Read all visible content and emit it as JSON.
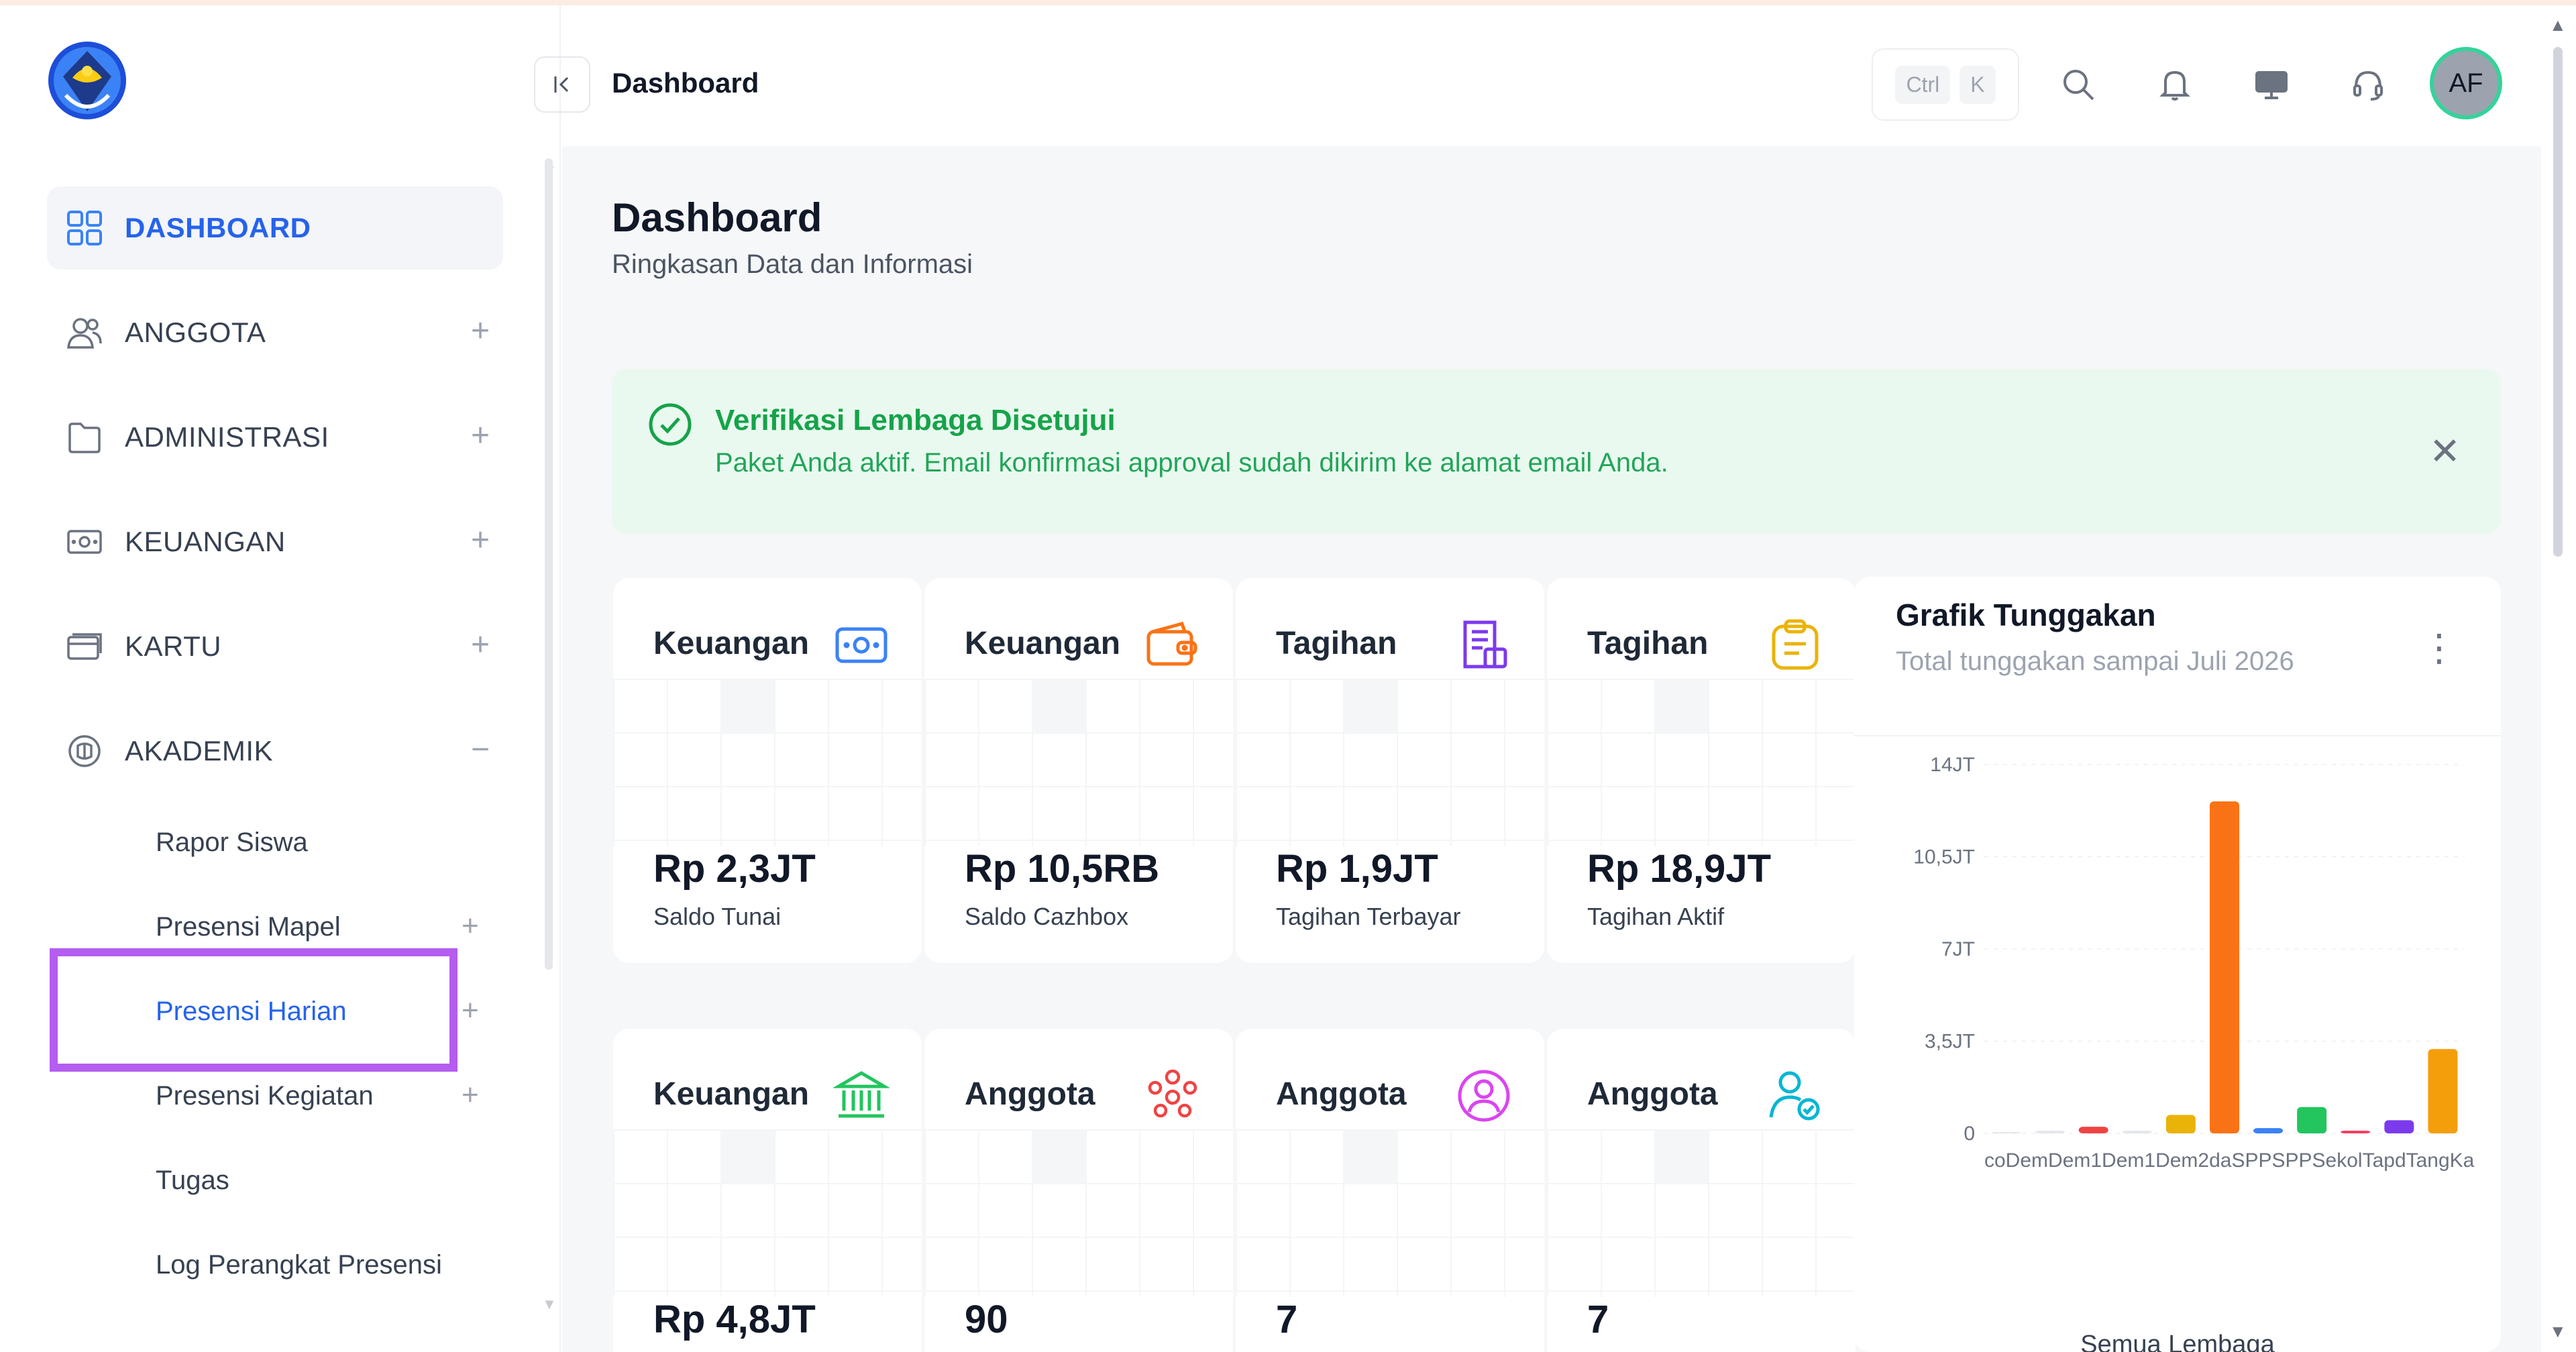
{
  "header": {
    "title": "Dashboard",
    "kbd_ctrl": "Ctrl",
    "kbd_k": "K",
    "avatar_initials": "AF"
  },
  "sidebar": {
    "items": [
      {
        "label": "DASHBOARD",
        "icon": "grid-icon",
        "active": true
      },
      {
        "label": "ANGGOTA",
        "icon": "users-icon",
        "toggle": "+"
      },
      {
        "label": "ADMINISTRASI",
        "icon": "folder-icon",
        "toggle": "+"
      },
      {
        "label": "KEUANGAN",
        "icon": "money-icon",
        "toggle": "+"
      },
      {
        "label": "KARTU",
        "icon": "card-icon",
        "toggle": "+"
      },
      {
        "label": "AKADEMIK",
        "icon": "academic-icon",
        "toggle": "−"
      }
    ],
    "subitems": [
      {
        "label": "Rapor Siswa"
      },
      {
        "label": "Presensi Mapel",
        "toggle": "+"
      },
      {
        "label": "Presensi Harian",
        "toggle": "+",
        "active": true
      },
      {
        "label": "Presensi Kegiatan",
        "toggle": "+"
      },
      {
        "label": "Tugas"
      },
      {
        "label": "Log Perangkat Presensi"
      }
    ]
  },
  "page": {
    "title": "Dashboard",
    "subtitle": "Ringkasan Data dan Informasi"
  },
  "alert": {
    "title": "Verifikasi Lembaga Disetujui",
    "message": "Paket Anda aktif. Email konfirmasi approval sudah dikirim ke alamat email Anda.",
    "close": "✕"
  },
  "cards": [
    {
      "title": "Keuangan",
      "value": "Rp 2,3JT",
      "label": "Saldo Tunai",
      "icon": "money-icon",
      "color": "#3b82f6"
    },
    {
      "title": "Keuangan",
      "value": "Rp 10,5RB",
      "label": "Saldo Cazhbox",
      "icon": "wallet-icon",
      "color": "#f97316"
    },
    {
      "title": "Tagihan",
      "value": "Rp 1,9JT",
      "label": "Tagihan Terbayar",
      "icon": "invoice-icon",
      "color": "#7c3aed"
    },
    {
      "title": "Tagihan",
      "value": "Rp 18,9JT",
      "label": "Tagihan Aktif",
      "icon": "clipboard-icon",
      "color": "#eab308"
    },
    {
      "title": "Keuangan",
      "value": "Rp 4,8JT",
      "label": "",
      "icon": "bank-icon",
      "color": "#22c55e"
    },
    {
      "title": "Anggota",
      "value": "90",
      "label": "",
      "icon": "group-icon",
      "color": "#ef4444"
    },
    {
      "title": "Anggota",
      "value": "7",
      "label": "",
      "icon": "user-circle-icon",
      "color": "#d946ef"
    },
    {
      "title": "Anggota",
      "value": "7",
      "label": "",
      "icon": "user-check-icon",
      "color": "#06b6d4"
    }
  ],
  "chart_card": {
    "title": "Grafik Tunggakan",
    "subtitle": "Total tunggakan sampai Juli 2026",
    "menu": "⋮",
    "footer": "Semua Lembaga"
  },
  "chart_data": {
    "type": "bar",
    "categories": [
      "co",
      "De",
      "De",
      "De",
      "De",
      "De",
      "SPP",
      "SPP",
      "Se",
      "Ta",
      "Ta",
      "Ka"
    ],
    "category_labels_raw": "coDeDeDeDeDeSPPSPPSeTaTaKa",
    "tick_label_text": "coDemDem1Dem1Dem2daSPPSPPSekolTapdTangKa",
    "values": [
      0.0,
      0.05,
      0.25,
      0.1,
      0.7,
      12.6,
      0.2,
      1.0,
      0.1,
      0.5,
      3.2
    ],
    "colors": [
      "#e5e7eb",
      "#e5e7eb",
      "#ef4444",
      "#e5e7eb",
      "#eab308",
      "#f97316",
      "#3b82f6",
      "#22c55e",
      "#f43f5e",
      "#7c3aed",
      "#f59e0b"
    ],
    "yticks": [
      "0",
      "3,5JT",
      "7JT",
      "10,5JT",
      "14JT"
    ],
    "ylim": [
      0,
      14
    ],
    "y_unit": "JT",
    "xlabel": "",
    "ylabel": "",
    "title": "Grafik Tunggakan"
  }
}
